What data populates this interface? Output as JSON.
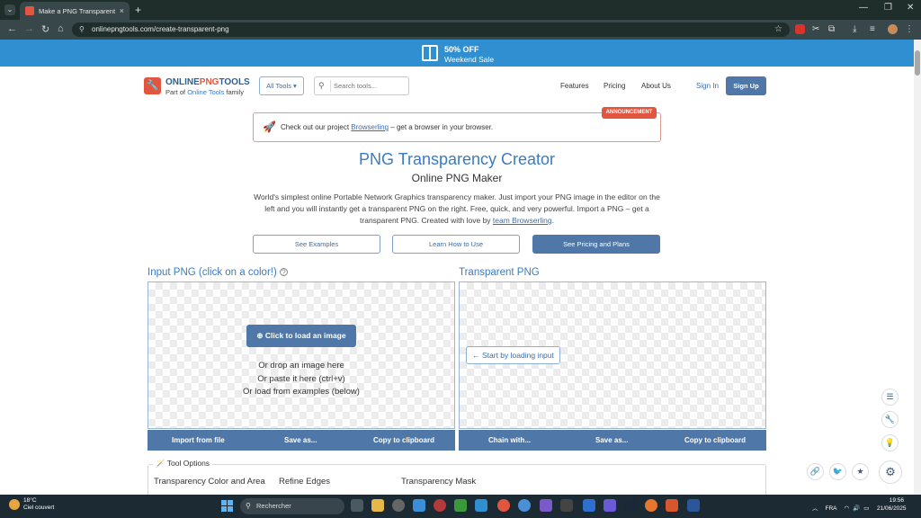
{
  "browser": {
    "tab_title": "Make a PNG Transparent – Onl",
    "url": "onlinepngtools.com/create-transparent-png",
    "tab_close": "×",
    "new_tab": "+"
  },
  "promo": {
    "line1": "50% OFF",
    "line2": "Weekend Sale"
  },
  "header": {
    "logo_part1": "ONLINE",
    "logo_part2": "PNG",
    "logo_part3": "TOOLS",
    "sub_prefix": "Part of ",
    "sub_link": "Online Tools",
    "sub_suffix": " family",
    "all_tools": "All Tools ▾",
    "search_placeholder": "Search tools...",
    "nav": [
      "Features",
      "Pricing",
      "About Us"
    ],
    "sign_in": "Sign In",
    "sign_up": "Sign Up"
  },
  "announcement": {
    "tag": "ANNOUNCEMENT",
    "prefix": "Check out our project ",
    "link": "Browserling",
    "suffix": " – get a browser in your browser."
  },
  "hero": {
    "title": "PNG Transparency Creator",
    "subtitle": "Online PNG Maker",
    "desc_main": "World's simplest online Portable Network Graphics transparency maker. Just import your PNG image in the editor on the left and you will instantly get a transparent PNG on the right. Free, quick, and very powerful. Import a PNG – get a transparent PNG. Created with love by ",
    "desc_link": "team Browserling",
    "desc_end": ".",
    "buttons": [
      "See Examples",
      "Learn How to Use",
      "See Pricing and Plans"
    ]
  },
  "input_panel": {
    "title": "Input PNG (click on a color!)",
    "help": "?",
    "load_button": "Click to load an image",
    "drop_lines": [
      "Or drop an image here",
      "Or paste it here (ctrl+v)",
      "Or load from examples (below)"
    ],
    "footer": [
      "Import from file",
      "Save as...",
      "Copy to clipboard"
    ]
  },
  "output_panel": {
    "title": "Transparent PNG",
    "start_button": "Start by loading input",
    "footer": [
      "Chain with...",
      "Save as...",
      "Copy to clipboard"
    ]
  },
  "options": {
    "label": "Tool Options",
    "columns": [
      "Transparency Color and Area",
      "Refine Edges",
      "Transparency Mask"
    ]
  },
  "taskbar": {
    "temp": "18°C",
    "weather": "Ciel couvert",
    "search": "Rechercher",
    "lang": "FRA",
    "time": "19:56",
    "date": "21/06/2025"
  },
  "colors": {
    "accent": "#4f78a8",
    "brand_red": "#e2553f",
    "promo_blue": "#2f8fd0"
  }
}
